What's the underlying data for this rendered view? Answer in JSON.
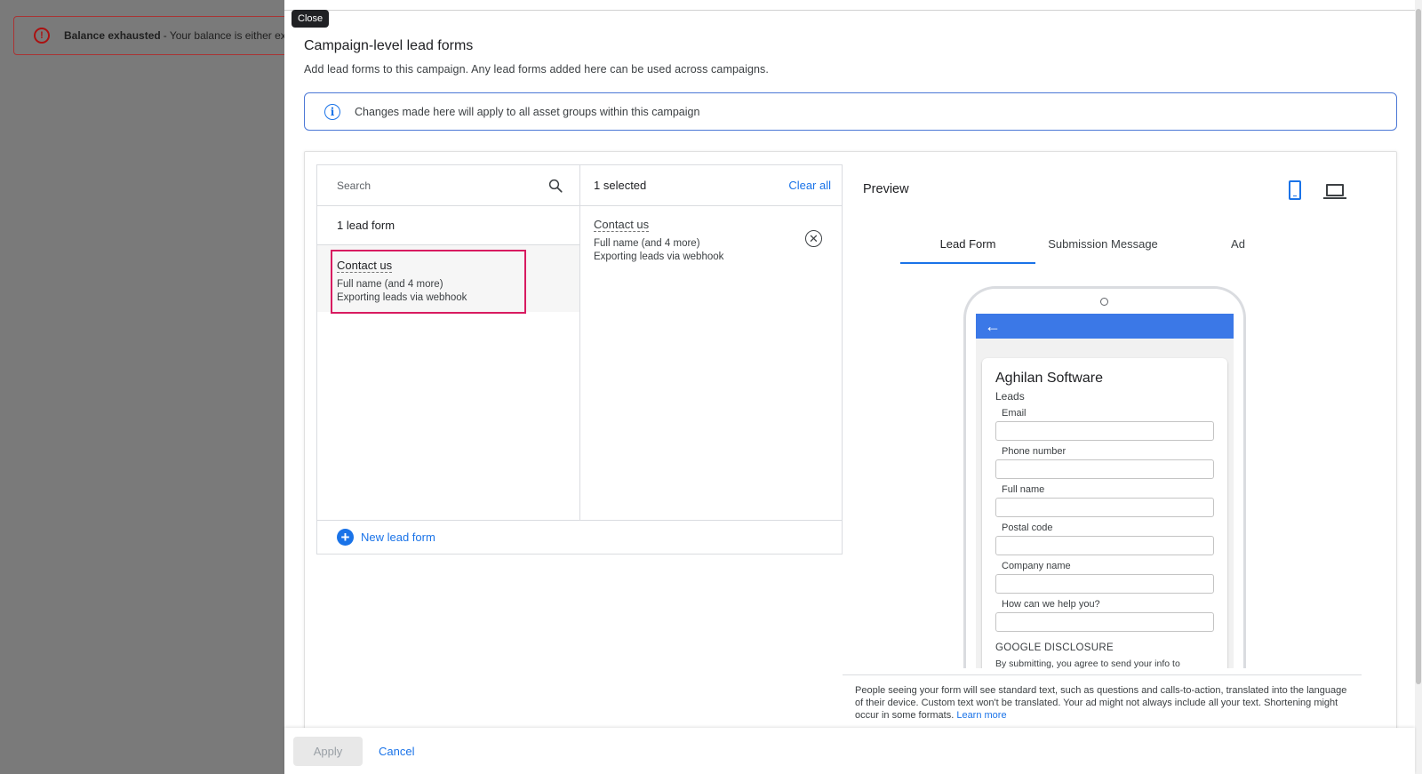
{
  "backdrop": {
    "alert_title": "Balance exhausted",
    "alert_text": " - Your balance is either exhausted"
  },
  "panel": {
    "close_tooltip": "Close",
    "title": "Campaign-level lead forms",
    "subtitle": "Add lead forms to this campaign. Any lead forms added here can be used across campaigns.",
    "info_text": "Changes made here will apply to all asset groups within this campaign"
  },
  "left": {
    "search_placeholder": "Search",
    "count": "1 lead form",
    "items": [
      {
        "name": "Contact us",
        "fields": "Full name (and 4 more)",
        "export": "Exporting leads via webhook"
      }
    ],
    "new_form": "New lead form"
  },
  "mid": {
    "selected_count": "1 selected",
    "clear_all": "Clear all",
    "items": [
      {
        "name": "Contact us",
        "fields": "Full name (and 4 more)",
        "export": "Exporting leads via webhook"
      }
    ]
  },
  "preview": {
    "title": "Preview",
    "tabs": [
      "Lead Form",
      "Submission Message",
      "Ad"
    ],
    "active_tab": "Lead Form",
    "brand": "Aghilan Software",
    "headline": "Leads",
    "fields": [
      "Email",
      "Phone number",
      "Full name",
      "Postal code",
      "Company name",
      "How can we help you?"
    ],
    "disclosure_title": "GOOGLE DISCLOSURE",
    "disclosure_text": "By submitting, you agree to send your info to",
    "note": "People seeing your form will see standard text, such as questions and calls-to-action, translated into the language of their device. Custom text won't be translated. Your ad might not always include all your text. Shortening might occur in some formats.",
    "learn_more": "Learn more"
  },
  "footer": {
    "apply": "Apply",
    "cancel": "Cancel"
  },
  "colors": {
    "accent": "#1a73e8",
    "highlight": "#d81b60",
    "phone_bar": "#3b78e7"
  }
}
